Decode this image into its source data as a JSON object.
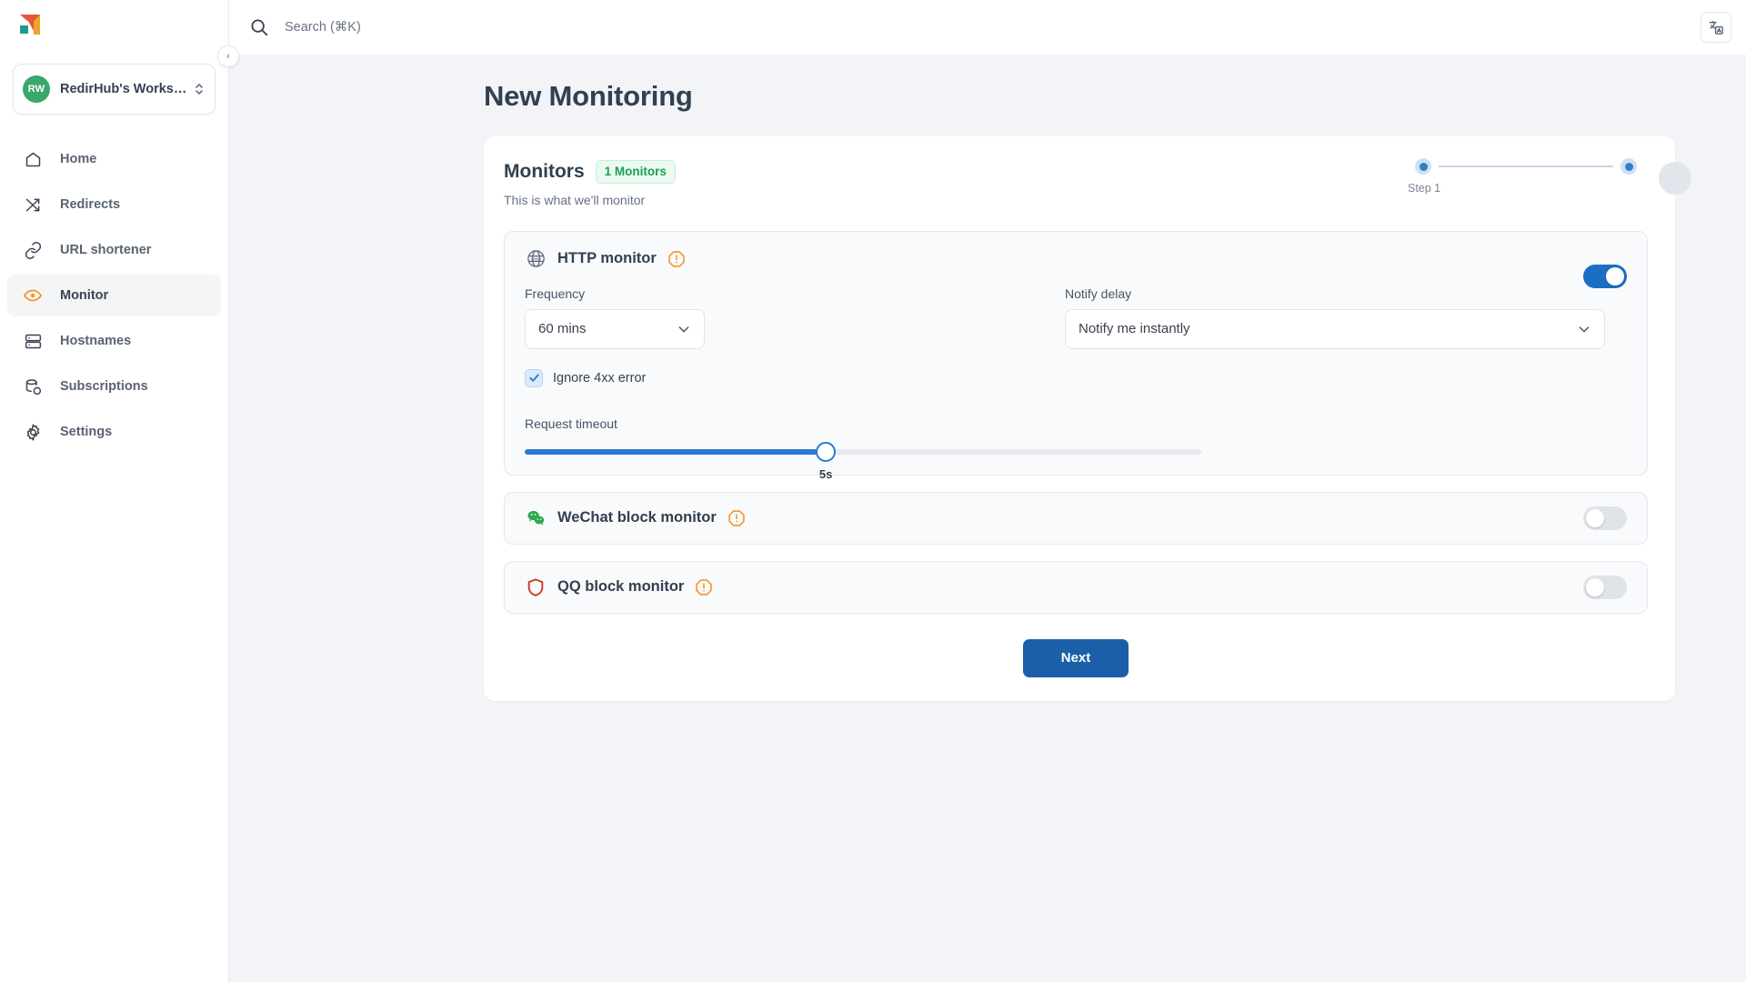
{
  "sidebar": {
    "logo_name": "redirhub-logo",
    "workspace": {
      "initials": "RW",
      "name": "RedirHub's Works…"
    },
    "collapse_label": "‹",
    "items": [
      {
        "label": "Home",
        "icon": "home-icon",
        "active": false
      },
      {
        "label": "Redirects",
        "icon": "shuffle-icon",
        "active": false
      },
      {
        "label": "URL shortener",
        "icon": "link-icon",
        "active": false
      },
      {
        "label": "Monitor",
        "icon": "eye-icon",
        "active": true
      },
      {
        "label": "Hostnames",
        "icon": "server-icon",
        "active": false
      },
      {
        "label": "Subscriptions",
        "icon": "database-icon",
        "active": false
      },
      {
        "label": "Settings",
        "icon": "gear-icon",
        "active": false
      }
    ]
  },
  "topbar": {
    "search_placeholder": "Search (⌘K)",
    "search_value": "",
    "translate_icon": "translate-icon"
  },
  "page": {
    "title": "New Monitoring"
  },
  "card": {
    "heading": "Monitors",
    "badge": "1 Monitors",
    "subtitle": "This is what we'll monitor",
    "steps": {
      "current_label": "Step 1",
      "total": 2
    },
    "next_label": "Next"
  },
  "monitors": [
    {
      "name": "HTTP monitor",
      "icon": "www-globe-icon",
      "warning_icon": "warning-octagon-icon",
      "enabled": true,
      "fields": {
        "frequency_label": "Frequency",
        "frequency_value": "60 mins",
        "notify_delay_label": "Notify delay",
        "notify_delay_value": "Notify me instantly",
        "ignore_4xx_label": "Ignore 4xx error",
        "ignore_4xx_checked": true,
        "timeout_label": "Request timeout",
        "timeout_value": "5s",
        "timeout_percent": 44.5
      }
    },
    {
      "name": "WeChat block monitor",
      "icon": "wechat-icon",
      "warning_icon": "warning-octagon-icon",
      "enabled": false
    },
    {
      "name": "QQ block monitor",
      "icon": "qq-shield-icon",
      "warning_icon": "warning-octagon-icon",
      "enabled": false
    }
  ],
  "colors": {
    "accent_blue": "#1a5fa8",
    "slider_blue": "#2b7ad1",
    "warning_orange": "#f59522",
    "badge_green": "#1f9d55",
    "wechat_green": "#2fa84f",
    "qq_red": "#cc3a20",
    "avatar_green": "#3aa76d"
  }
}
